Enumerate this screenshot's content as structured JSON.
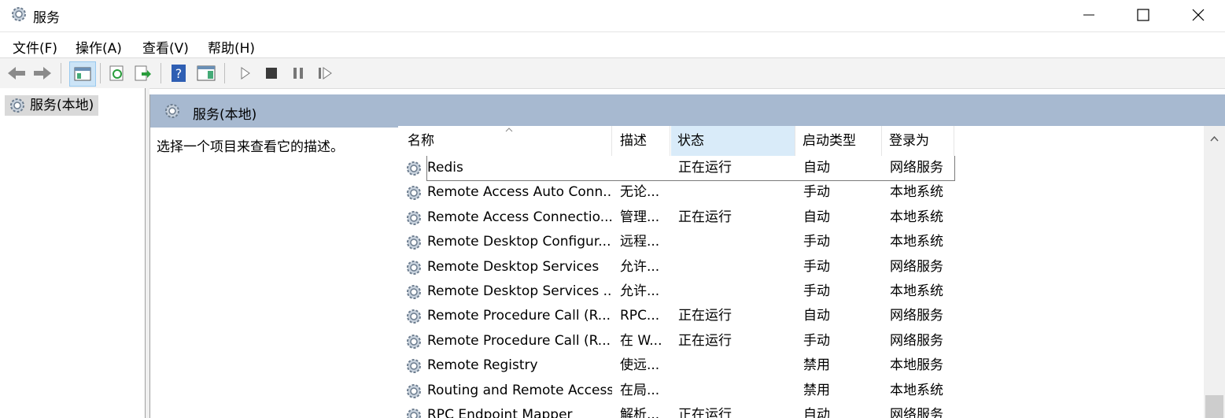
{
  "window": {
    "title": "服务"
  },
  "menu": [
    "文件(F)",
    "操作(A)",
    "查看(V)",
    "帮助(H)"
  ],
  "toolbar": [
    "back-icon",
    "forward-icon",
    "console-tree-icon",
    "refresh-icon",
    "export-icon",
    "help-icon",
    "properties-icon",
    "start-icon",
    "stop-icon",
    "pause-icon",
    "restart-icon"
  ],
  "tree": {
    "label": "服务(本地)"
  },
  "panel": {
    "title": "服务(本地)",
    "description": "选择一个项目来查看它的描述。"
  },
  "columns": {
    "name": "名称",
    "desc": "描述",
    "status": "状态",
    "startup": "启动类型",
    "logon": "登录为"
  },
  "rows": [
    {
      "name": "Redis",
      "desc": "",
      "status": "正在运行",
      "startup": "自动",
      "logon": "网络服务"
    },
    {
      "name": "Remote Access Auto Conn...",
      "desc": "无论...",
      "status": "",
      "startup": "手动",
      "logon": "本地系统"
    },
    {
      "name": "Remote Access Connectio...",
      "desc": "管理...",
      "status": "正在运行",
      "startup": "自动",
      "logon": "本地系统"
    },
    {
      "name": "Remote Desktop Configur...",
      "desc": "远程...",
      "status": "",
      "startup": "手动",
      "logon": "本地系统"
    },
    {
      "name": "Remote Desktop Services",
      "desc": "允许...",
      "status": "",
      "startup": "手动",
      "logon": "网络服务"
    },
    {
      "name": "Remote Desktop Services ...",
      "desc": "允许...",
      "status": "",
      "startup": "手动",
      "logon": "本地系统"
    },
    {
      "name": "Remote Procedure Call (R...",
      "desc": "RPC...",
      "status": "正在运行",
      "startup": "自动",
      "logon": "网络服务"
    },
    {
      "name": "Remote Procedure Call (R...",
      "desc": "在 W...",
      "status": "正在运行",
      "startup": "手动",
      "logon": "网络服务"
    },
    {
      "name": "Remote Registry",
      "desc": "使远...",
      "status": "",
      "startup": "禁用",
      "logon": "本地服务"
    },
    {
      "name": "Routing and Remote Access",
      "desc": "在局...",
      "status": "",
      "startup": "禁用",
      "logon": "本地系统"
    },
    {
      "name": "RPC Endpoint Mapper",
      "desc": "解析...",
      "status": "正在运行",
      "startup": "自动",
      "logon": "网络服务"
    }
  ]
}
